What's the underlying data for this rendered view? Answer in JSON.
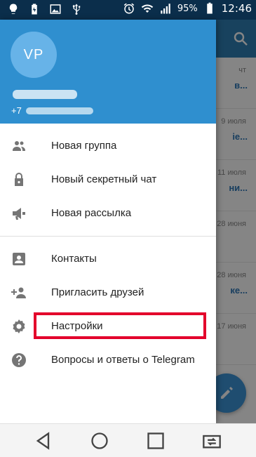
{
  "status_bar": {
    "battery_percent": "95%",
    "time": "12:46"
  },
  "drawer": {
    "avatar_initials": "VP",
    "phone_prefix": "+7",
    "menu": [
      {
        "label": "Новая группа",
        "icon": "group-icon"
      },
      {
        "label": "Новый секретный чат",
        "icon": "lock-icon"
      },
      {
        "label": "Новая рассылка",
        "icon": "broadcast-icon"
      },
      {
        "label": "Контакты",
        "icon": "contacts-icon"
      },
      {
        "label": "Пригласить друзей",
        "icon": "add-person-icon"
      },
      {
        "label": "Настройки",
        "icon": "settings-icon"
      },
      {
        "label": "Вопросы и ответы о Telegram",
        "icon": "help-icon"
      }
    ]
  },
  "background": {
    "rows": [
      {
        "date": "чт",
        "preview": "в..."
      },
      {
        "date": "9 июля",
        "preview": "ie..."
      },
      {
        "date": "11 июля",
        "preview": "ни..."
      },
      {
        "date": "28 июня",
        "preview": ""
      },
      {
        "date": "28 июня",
        "preview": "ке..."
      },
      {
        "date": "17 июня",
        "preview": ""
      }
    ]
  },
  "colors": {
    "drawer_header": "#2f8fcf",
    "avatar": "#67b3e8",
    "highlight": "#e3002b",
    "status_bar": "#0b2e4b"
  }
}
